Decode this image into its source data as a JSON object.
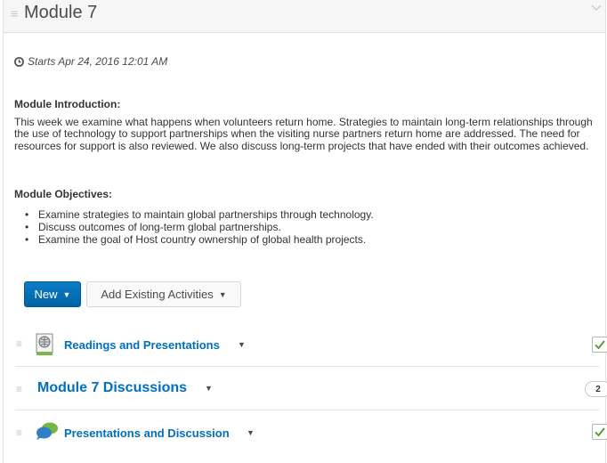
{
  "module": {
    "title": "Module 7",
    "starts": "Starts Apr 24, 2016 12:01 AM"
  },
  "intro": {
    "heading": "Module Introduction:",
    "text": "This week we examine what happens when volunteers return home. Strategies to maintain long-term relationships through the use of technology to support partnerships when the visiting nurse partners return home are addressed. The need for resources for support is also reviewed. We also discuss long-term projects that have ended with their outcomes achieved."
  },
  "objectives": {
    "heading": "Module Objectives:",
    "items": [
      "Examine strategies to maintain global partnerships through technology.",
      "Discuss outcomes of long-term global partnerships.",
      "Examine the goal of Host country ownership of global health projects."
    ]
  },
  "toolbar": {
    "new_label": "New",
    "add_label": "Add Existing Activities"
  },
  "items": [
    {
      "label": "Readings and Presentations",
      "icon": "globe-document-icon",
      "status": "completed"
    },
    {
      "label": "Module 7 Discussions",
      "badge": "2"
    },
    {
      "label": "Presentations and Discussion",
      "icon": "chat-bubbles-icon",
      "status": "completed"
    }
  ],
  "colors": {
    "link": "#006fbf",
    "primary_button": "#0d7ec4",
    "check": "#4c9a2a"
  }
}
